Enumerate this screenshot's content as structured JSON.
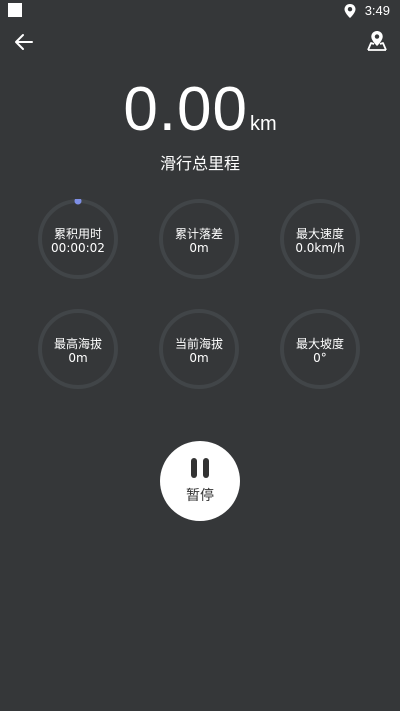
{
  "status_bar": {
    "time": "3:49"
  },
  "header": {
    "back_icon": "arrow-left-icon",
    "map_icon": "map-pin-icon"
  },
  "distance": {
    "value": "0.00",
    "unit": "km",
    "label": "滑行总里程"
  },
  "stats": [
    {
      "label": "累积用时",
      "value": "00:00:02"
    },
    {
      "label": "累计落差",
      "value": "0m"
    },
    {
      "label": "最大速度",
      "value": "0.0km/h"
    },
    {
      "label": "最高海拔",
      "value": "0m"
    },
    {
      "label": "当前海拔",
      "value": "0m"
    },
    {
      "label": "最大坡度",
      "value": "0°"
    }
  ],
  "pause_button": {
    "label": "暂停",
    "icon": "pause-icon"
  },
  "colors": {
    "background": "#353739",
    "ring": "#414548",
    "progress_dot": "#7e8fe6"
  }
}
